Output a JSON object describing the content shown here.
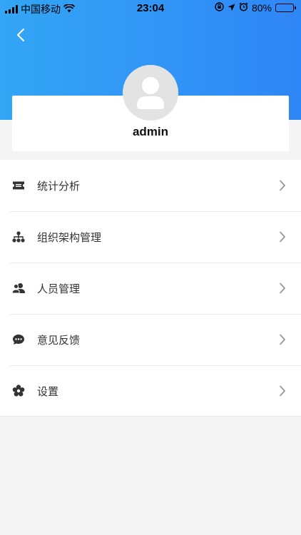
{
  "status_bar": {
    "carrier": "中国移动",
    "time": "23:04",
    "battery_percent": "80%",
    "battery_level": 0.8,
    "icons": [
      "signal-icon",
      "wifi-icon",
      "orientation-lock-icon",
      "location-icon",
      "alarm-icon",
      "battery-icon"
    ]
  },
  "header": {
    "back_icon": "back-arrow-icon",
    "gradient_from": "#33a6f5",
    "gradient_to": "#2f86f6"
  },
  "profile": {
    "avatar_icon": "default-avatar-icon",
    "username": "admin"
  },
  "menu": {
    "items": [
      {
        "label": "统计分析",
        "icon": "ticket-icon"
      },
      {
        "label": "组织架构管理",
        "icon": "org-chart-icon"
      },
      {
        "label": "人员管理",
        "icon": "people-icon"
      },
      {
        "label": "意见反馈",
        "icon": "chat-bubble-icon"
      },
      {
        "label": "设置",
        "icon": "settings-gear-icon"
      }
    ],
    "chevron_icon": "chevron-right-icon"
  }
}
